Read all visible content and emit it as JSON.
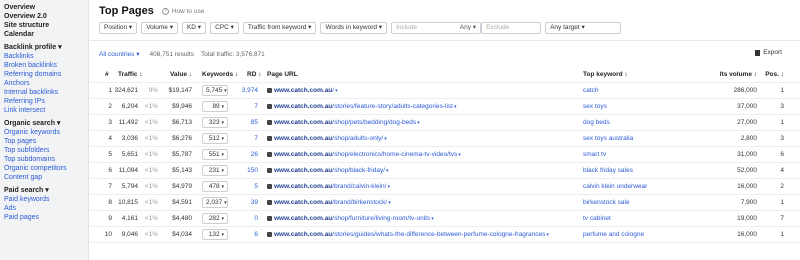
{
  "sidebar": {
    "items": [
      {
        "label": "Overview",
        "type": "head"
      },
      {
        "label": "Overview 2.0",
        "type": "head"
      },
      {
        "label": "Site structure",
        "type": "head"
      },
      {
        "label": "Calendar",
        "type": "head"
      },
      {
        "label": "Backlink profile ▾",
        "type": "head"
      },
      {
        "label": "Backlinks",
        "type": "link"
      },
      {
        "label": "Broken backlinks",
        "type": "link"
      },
      {
        "label": "Referring domains",
        "type": "link"
      },
      {
        "label": "Anchors",
        "type": "link"
      },
      {
        "label": "Internal backlinks",
        "type": "link"
      },
      {
        "label": "Referring IPs",
        "type": "link"
      },
      {
        "label": "Link intersect",
        "type": "link"
      },
      {
        "label": "Organic search ▾",
        "type": "head"
      },
      {
        "label": "Organic keywords",
        "type": "link"
      },
      {
        "label": "Top pages",
        "type": "link"
      },
      {
        "label": "Top subfolders",
        "type": "link"
      },
      {
        "label": "Top subdomains",
        "type": "link"
      },
      {
        "label": "Organic competitors",
        "type": "link"
      },
      {
        "label": "Content gap",
        "type": "link"
      },
      {
        "label": "Paid search ▾",
        "type": "head"
      },
      {
        "label": "Paid keywords",
        "type": "link"
      },
      {
        "label": "Ads",
        "type": "link"
      },
      {
        "label": "Paid pages",
        "type": "link"
      }
    ]
  },
  "page": {
    "title": "Top Pages",
    "howto": "How to use",
    "howto_icon": "question-icon"
  },
  "filters": {
    "position": "Position ▾",
    "volume": "Volume ▾",
    "kd": "KD ▾",
    "cpc": "CPC ▾",
    "traffic_from_keyword": "Traffic from keyword ▾",
    "words_in_keyword": "Words in keyword ▾",
    "include_placeholder": "Include",
    "include_any": "Any ▾",
    "exclude_placeholder": "Exclude",
    "any_target": "Any target ▾"
  },
  "summary": {
    "countries": "All countries ▾",
    "results": "408,751 results",
    "total_traffic": "Total traffic: 3,576,871",
    "export": "Export"
  },
  "table": {
    "headers": {
      "num": "#",
      "traffic": "Traffic ↕",
      "value": "Value ↓",
      "keywords": "Keywords ↕",
      "rd": "RD ↕",
      "page_url": "Page URL",
      "top_keyword": "Top keyword ↕",
      "its_volume": "Its volume ↕",
      "pos": "Pos. ↕"
    },
    "rows": [
      {
        "num": "1",
        "traffic": "324,621",
        "pct": "9%",
        "value": "$19,147",
        "keywords": "5,745",
        "rd": "3,974",
        "domain": "www.catch.com.au",
        "path": "/",
        "top_keyword": "catch",
        "volume": "286,000",
        "pos": "1"
      },
      {
        "num": "2",
        "traffic": "6,204",
        "pct": "<1%",
        "value": "$9,946",
        "keywords": "89",
        "rd": "7",
        "domain": "www.catch.com.au",
        "path": "/stories/feature-story/adults-categories-list",
        "top_keyword": "sex toys",
        "volume": "37,000",
        "pos": "3"
      },
      {
        "num": "3",
        "traffic": "11,492",
        "pct": "<1%",
        "value": "$6,713",
        "keywords": "323",
        "rd": "85",
        "domain": "www.catch.com.au",
        "path": "/shop/pets/bedding/dog-beds",
        "top_keyword": "dog beds",
        "volume": "27,000",
        "pos": "1"
      },
      {
        "num": "4",
        "traffic": "3,036",
        "pct": "<1%",
        "value": "$6,276",
        "keywords": "512",
        "rd": "7",
        "domain": "www.catch.com.au",
        "path": "/shop/adults-only/",
        "top_keyword": "sex toys australia",
        "volume": "2,800",
        "pos": "3"
      },
      {
        "num": "5",
        "traffic": "5,651",
        "pct": "<1%",
        "value": "$5,787",
        "keywords": "551",
        "rd": "26",
        "domain": "www.catch.com.au",
        "path": "/shop/electronics/home-cinema-tv-video/tvs",
        "top_keyword": "smart tv",
        "volume": "31,000",
        "pos": "6"
      },
      {
        "num": "6",
        "traffic": "11,094",
        "pct": "<1%",
        "value": "$5,143",
        "keywords": "231",
        "rd": "150",
        "domain": "www.catch.com.au",
        "path": "/shop/black-friday/",
        "top_keyword": "black friday sales",
        "volume": "52,000",
        "pos": "4"
      },
      {
        "num": "7",
        "traffic": "5,794",
        "pct": "<1%",
        "value": "$4,979",
        "keywords": "478",
        "rd": "5",
        "domain": "www.catch.com.au",
        "path": "/brand/calvin-klein/",
        "top_keyword": "calvin klein underwear",
        "volume": "16,000",
        "pos": "2"
      },
      {
        "num": "8",
        "traffic": "10,815",
        "pct": "<1%",
        "value": "$4,591",
        "keywords": "2,037",
        "rd": "39",
        "domain": "www.catch.com.au",
        "path": "/brand/birkenstock/",
        "top_keyword": "birkenstock sale",
        "volume": "7,900",
        "pos": "1"
      },
      {
        "num": "9",
        "traffic": "4,161",
        "pct": "<1%",
        "value": "$4,480",
        "keywords": "282",
        "rd": "0",
        "domain": "www.catch.com.au",
        "path": "/shop/furniture/living-room/tv-units",
        "top_keyword": "tv cabinet",
        "volume": "19,000",
        "pos": "7"
      },
      {
        "num": "10",
        "traffic": "9,046",
        "pct": "<1%",
        "value": "$4,034",
        "keywords": "132",
        "rd": "6",
        "domain": "www.catch.com.au",
        "path": "/stories/guides/whats-the-difference-between-perfume-cologne-fragrances",
        "top_keyword": "perfume and cologne",
        "volume": "16,000",
        "pos": "1"
      }
    ]
  },
  "colors": {
    "link": "#2a5bd7",
    "sidebar_bg": "#f2f3f5"
  }
}
